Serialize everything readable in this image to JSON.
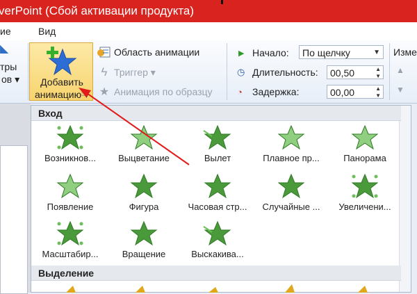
{
  "window": {
    "title": "verPoint (Сбой активации продукта)"
  },
  "menu": {
    "tabs": [
      "ие",
      "Вид"
    ]
  },
  "ribbon": {
    "left_fragment": {
      "line1": "тры",
      "line2": "ов ▾"
    },
    "add_animation": {
      "line1": "Добавить",
      "line2": "анимацию ▾"
    },
    "animation_pane": "Область анимации",
    "trigger": "Триггер ▾",
    "animation_painter": "Анимация по образцу",
    "start": {
      "label": "Начало:",
      "value": "По щелчку"
    },
    "duration": {
      "label": "Длительность:",
      "value": "00,50"
    },
    "delay": {
      "label": "Задержка:",
      "value": "00,00"
    },
    "reorder_fragment": "Изме"
  },
  "gallery": {
    "sections": [
      {
        "title": "Вход",
        "items": [
          {
            "name": "Возникнов...",
            "icon": "appear-star-icon"
          },
          {
            "name": "Выцветание",
            "icon": "fade-star-icon"
          },
          {
            "name": "Вылет",
            "icon": "fly-in-star-icon"
          },
          {
            "name": "Плавное пр...",
            "icon": "float-in-star-icon"
          },
          {
            "name": "Панорама",
            "icon": "wipe-star-icon"
          },
          {
            "name": "Появление",
            "icon": "shape-in-star-icon"
          },
          {
            "name": "Фигура",
            "icon": "figure-star-icon"
          },
          {
            "name": "Часовая стр...",
            "icon": "wheel-star-icon"
          },
          {
            "name": "Случайные ...",
            "icon": "random-bars-star-icon"
          },
          {
            "name": "Увеличени...",
            "icon": "grow-turn-star-icon"
          },
          {
            "name": "Масштабир...",
            "icon": "zoom-star-icon"
          },
          {
            "name": "Вращение",
            "icon": "swivel-star-icon"
          },
          {
            "name": "Выскакива...",
            "icon": "bounce-star-icon"
          }
        ]
      },
      {
        "title": "Выделение",
        "items": []
      }
    ]
  },
  "colors": {
    "title_bar": "#d9231f",
    "star_green": "#4a9a3b",
    "star_gold": "#e0a81a",
    "annotation_arrow": "#e21a1a"
  }
}
